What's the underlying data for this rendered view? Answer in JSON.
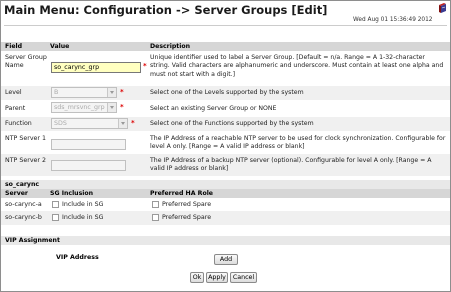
{
  "page": {
    "title": "Main Menu: Configuration -> Server Groups [Edit]",
    "datetime": "Wed Aug 01 15:36:49 2012"
  },
  "table": {
    "col_field": "Field",
    "col_value": "Value",
    "col_description": "Description"
  },
  "fields": {
    "name": {
      "label": "Server Group Name",
      "value": "so_carync_grp",
      "description": "Unique identifier used to label a Server Group. [Default = n/a. Range = A 1-32-character string. Valid characters are alphanumeric and underscore. Must contain at least one alpha and must not start with a digit.]"
    },
    "level": {
      "label": "Level",
      "value": "B",
      "description": "Select one of the Levels supported by the system"
    },
    "parent": {
      "label": "Parent",
      "value": "sds_mrsvnc_grp",
      "description": "Select an existing Server Group or NONE"
    },
    "function": {
      "label": "Function",
      "value": "SDS",
      "description": "Select one of the Functions supported by the system"
    },
    "ntp1": {
      "label": "NTP Server 1",
      "value": "",
      "description": "The IP Address of a reachable NTP server to be used for clock synchronization. Configurable for level A only. [Range = A valid IP address or blank]"
    },
    "ntp2": {
      "label": "NTP Server 2",
      "value": "",
      "description": "The IP Address of a backup NTP server (optional). Configurable for level A only. [Range = A valid IP address or blank]"
    }
  },
  "servers_section": {
    "title": "so_carync",
    "col_server": "Server",
    "col_sg_inclusion": "SG Inclusion",
    "col_ha_role": "Preferred HA Role",
    "rows": [
      {
        "server": "so-carync-a",
        "include_label": "Include in SG",
        "preferred_label": "Preferred Spare"
      },
      {
        "server": "so-carync-b",
        "include_label": "Include in SG",
        "preferred_label": "Preferred Spare"
      }
    ]
  },
  "vip": {
    "title": "VIP Assignment",
    "label": "VIP Address",
    "add_button": "Add"
  },
  "buttons": {
    "ok": "Ok",
    "apply": "Apply",
    "cancel": "Cancel"
  },
  "colors": {
    "required": "#dd0000",
    "focus_field": "#ffffc0",
    "header_bg": "#d6d6d6"
  },
  "icons": {
    "help": "book-icon"
  }
}
